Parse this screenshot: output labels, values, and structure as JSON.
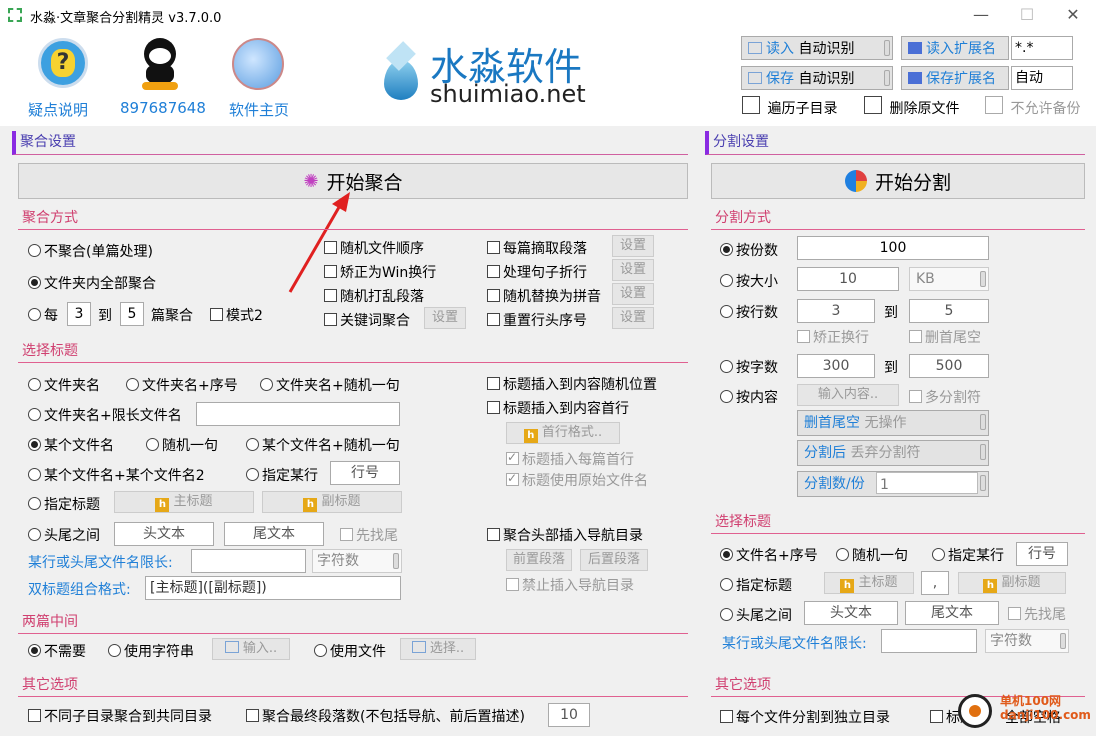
{
  "window": {
    "title": "水淼·文章聚合分割精灵 v3.7.0.0",
    "minimize": "—",
    "maximize": "☐",
    "close": "✕"
  },
  "header": {
    "help_label": "疑点说明",
    "qq_label": "897687648",
    "home_label": "软件主页",
    "logo_cn": "水淼软件",
    "logo_en": "shuimiao.net",
    "read_btn": "读入",
    "read_value": "自动识别",
    "read_ext_btn": "读入扩展名",
    "read_ext_value": "*.*",
    "save_btn": "保存",
    "save_value": "自动识别",
    "save_ext_btn": "保存扩展名",
    "save_ext_value": "自动",
    "traverse": "遍历子目录",
    "delete_src": "删除原文件",
    "no_backup": "不允许备份"
  },
  "merge": {
    "section": "聚合设置",
    "start": "开始聚合",
    "mode_title": "聚合方式",
    "no_merge": "不聚合(单篇处理)",
    "all_merge": "文件夹内全部聚合",
    "every": "每",
    "from": "3",
    "to_label": "到",
    "to": "5",
    "per_label": "篇聚合",
    "mode2": "模式2",
    "random_order": "随机文件顺序",
    "fix_win": "矫正为Win换行",
    "shuffle_para": "随机打乱段落",
    "keyword_merge": "关键词聚合",
    "extract_para": "每篇摘取段落",
    "handle_wrap": "处理句子折行",
    "pinyin": "随机替换为拼音",
    "reset_num": "重置行头序号",
    "setting": "设置",
    "title_section": "选择标题",
    "t_folder": "文件夹名",
    "t_folder_seq": "文件夹名+序号",
    "t_folder_rand": "文件夹名+随机一句",
    "t_folder_limit": "文件夹名+限长文件名",
    "t_file": "某个文件名",
    "t_rand": "随机一句",
    "t_file_rand": "某个文件名+随机一句",
    "t_file2": "某个文件名+某个文件名2",
    "t_line": "指定某行",
    "line_ph": "行号",
    "t_specify": "指定标题",
    "main_title": "主标题",
    "sub_title": "副标题",
    "t_headtail": "头尾之间",
    "head_text": "头文本",
    "tail_text": "尾文本",
    "tail_first": "先找尾",
    "limit_label": "某行或头尾文件名限长:",
    "chars": "字符数",
    "combo_label": "双标题组合格式:",
    "combo_value": "[主标题]([副标题])",
    "insert_rand": "标题插入到内容随机位置",
    "insert_first": "标题插入到内容首行",
    "first_fmt": "首行格式..",
    "insert_each": "标题插入每篇首行",
    "use_orig": "标题使用原始文件名",
    "nav_insert": "聚合头部插入导航目录",
    "pre_para": "前置段落",
    "post_para": "后置段落",
    "no_nav": "禁止插入导航目录",
    "between": "两篇中间",
    "not_need": "不需要",
    "use_str": "使用字符串",
    "input_btn": "输入..",
    "use_file": "使用文件",
    "select_btn": "选择..",
    "other": "其它选项",
    "diff_dir": "不同子目录聚合到共同目录",
    "final_count": "聚合最终段落数(不包括导航、前后置描述)",
    "final_value": "10"
  },
  "split": {
    "section": "分割设置",
    "start": "开始分割",
    "mode_title": "分割方式",
    "by_copies": "按份数",
    "copies": "100",
    "by_size": "按大小",
    "size": "10",
    "unit": "KB",
    "by_lines": "按行数",
    "lines_from": "3",
    "to": "到",
    "lines_to": "5",
    "fix_wrap": "矫正换行",
    "del_tail": "删首尾空",
    "by_chars": "按字数",
    "chars_from": "300",
    "chars_to": "500",
    "by_content": "按内容",
    "content_btn": "输入内容..",
    "multi_sep": "多分割符",
    "trim_label": "删首尾空",
    "trim_value": "无操作",
    "after_label": "分割后",
    "after_value": "丢弃分割符",
    "per_label": "分割数/份",
    "per_value": "1",
    "title_section": "选择标题",
    "name_seq": "文件名+序号",
    "rand": "随机一句",
    "line": "指定某行",
    "line_ph": "行号",
    "specify": "指定标题",
    "main": "主标题",
    "comma": ",",
    "sub": "副标题",
    "headtail": "头尾之间",
    "head": "头文本",
    "tail": "尾文本",
    "tail_first": "先找尾",
    "limit": "某行或头尾文件名限长:",
    "chars": "字符数",
    "other": "其它选项",
    "each_dir": "每个文件分割到独立目录",
    "title_label": "标题",
    "all_space": "全部空格"
  },
  "watermark": "单机100网 danji100.com"
}
